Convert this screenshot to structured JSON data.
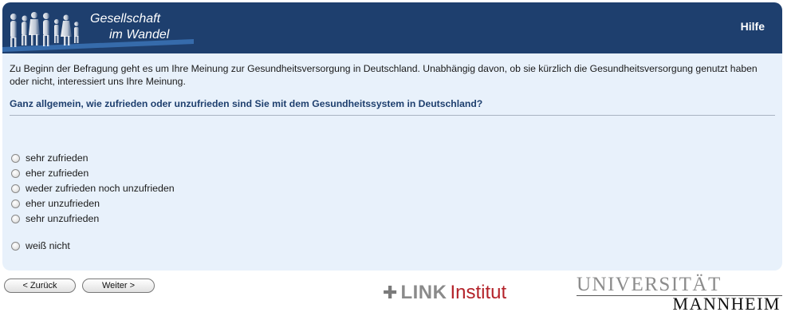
{
  "header": {
    "logo_line1": "Gesellschaft",
    "logo_line2": "im Wandel",
    "help_label": "Hilfe"
  },
  "intro_text": "Zu Beginn der Befragung geht es um Ihre Meinung zur Gesundheitsversorgung in Deutschland. Unabhängig davon, ob sie kürzlich die Gesundheitsversorgung genutzt haben oder nicht, interessiert uns Ihre Meinung.",
  "question": "Ganz allgemein, wie zufrieden oder unzufrieden sind Sie mit dem Gesundheitssystem in Deutschland?",
  "options": [
    "sehr zufrieden",
    "eher zufrieden",
    "weder zufrieden noch unzufrieden",
    "eher unzufrieden",
    "sehr unzufrieden",
    "weiß nicht"
  ],
  "nav": {
    "back_label": "< Zurück",
    "next_label": "Weiter >"
  },
  "footer": {
    "link_word": "LINK",
    "link_inst": "Institut",
    "uni_top": "UNIVERSITÄT",
    "uni_bottom": "MANNHEIM"
  },
  "colors": {
    "header": "#1e3f6e",
    "panel": "#e8f1fb",
    "question": "#1e3f6e",
    "link_red": "#b4232a"
  }
}
